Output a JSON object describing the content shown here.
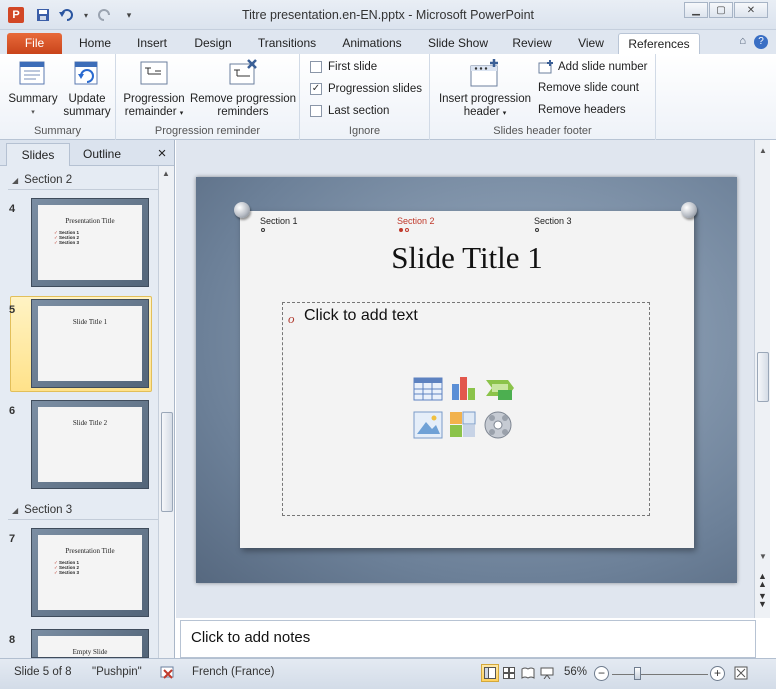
{
  "window": {
    "title": "Titre presentation.en-EN.pptx  -  Microsoft PowerPoint",
    "app_icon_letter": "P"
  },
  "tabs": {
    "file": "File",
    "items": [
      "Home",
      "Insert",
      "Design",
      "Transitions",
      "Animations",
      "Slide Show",
      "Review",
      "View",
      "References"
    ],
    "active": "References"
  },
  "ribbon": {
    "summary_group": {
      "label": "Summary",
      "summary_btn": "Summary",
      "update_summary_line1": "Update",
      "update_summary_line2": "summary"
    },
    "progression_group": {
      "label": "Progression reminder",
      "progression_line1": "Progression",
      "progression_line2": "remainder",
      "remove_line1": "Remove progression",
      "remove_line2": "reminders"
    },
    "ignore_group": {
      "label": "Ignore",
      "first_slide": "First slide",
      "progression_slides": "Progression slides",
      "last_section": "Last section",
      "first_slide_checked": false,
      "progression_slides_checked": true,
      "last_section_checked": false
    },
    "header_group": {
      "label": "Slides header  footer",
      "insert_line1": "Insert progression",
      "insert_line2": "header",
      "add_slide_number": "Add slide number",
      "remove_slide_count": "Remove slide count",
      "remove_headers": "Remove headers"
    }
  },
  "left_panel": {
    "tab_slides": "Slides",
    "tab_outline": "Outline",
    "close": "×",
    "section2": "Section 2",
    "section3": "Section 3",
    "thumbs": [
      {
        "num": "4",
        "title": "Presentation   Title",
        "bullets": [
          "Section 1",
          "Section 2",
          "Section 3"
        ]
      },
      {
        "num": "5",
        "title": "Slide Title 1"
      },
      {
        "num": "6",
        "title": "Slide Title 2"
      },
      {
        "num": "7",
        "title": "Presentation   Title",
        "bullets": [
          "Section 1",
          "Section 2",
          "Section 3"
        ]
      },
      {
        "num": "8",
        "title": "Empty Slide"
      }
    ]
  },
  "slide": {
    "nav": [
      "Section 1",
      "Section 2",
      "Section 3"
    ],
    "title": "Slide Title 1",
    "placeholder": "Click to add text",
    "bullet_glyph": "o"
  },
  "notes": {
    "placeholder": "Click to add notes"
  },
  "status": {
    "slide_of": "Slide 5 of 8",
    "theme": "\"Pushpin\"",
    "language": "French (France)",
    "zoom": "56%"
  },
  "colors": {
    "file_tab": "#d24726",
    "active_section": "#c0392b",
    "selection": "#ffe28a"
  }
}
